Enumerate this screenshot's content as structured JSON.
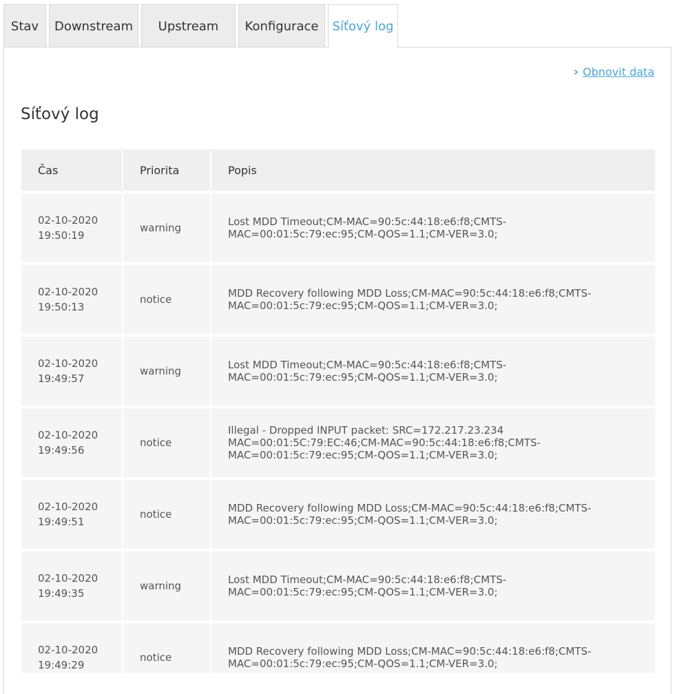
{
  "tabs": [
    {
      "label": "Stav",
      "width": 62,
      "active": false
    },
    {
      "label": "Downstream",
      "width": 130,
      "active": false
    },
    {
      "label": "Upstream",
      "width": 137,
      "active": false
    },
    {
      "label": "Konfigurace",
      "width": 126,
      "active": false
    },
    {
      "label": "Síťový log",
      "width": 102,
      "active": true
    }
  ],
  "refresh_label": "Obnovit data",
  "page_title": "Síťový log",
  "table": {
    "headers": [
      "Čas",
      "Priorita",
      "Popis"
    ],
    "rows": [
      {
        "time": "02-10-2020 19:50:19",
        "priority": "warning",
        "desc": "Lost MDD Timeout;CM-MAC=90:5c:44:18:e6:f8;CMTS-MAC=00:01:5c:79:ec:95;CM-QOS=1.1;CM-VER=3.0;"
      },
      {
        "time": "02-10-2020 19:50:13",
        "priority": "notice",
        "desc": "MDD Recovery following MDD Loss;CM-MAC=90:5c:44:18:e6:f8;CMTS-MAC=00:01:5c:79:ec:95;CM-QOS=1.1;CM-VER=3.0;"
      },
      {
        "time": "02-10-2020 19:49:57",
        "priority": "warning",
        "desc": "Lost MDD Timeout;CM-MAC=90:5c:44:18:e6:f8;CMTS-MAC=00:01:5c:79:ec:95;CM-QOS=1.1;CM-VER=3.0;"
      },
      {
        "time": "02-10-2020 19:49:56",
        "priority": "notice",
        "desc": "Illegal - Dropped INPUT packet: SRC=172.217.23.234 MAC=00:01:5C:79:EC:46;CM-MAC=90:5c:44:18:e6:f8;CMTS-MAC=00:01:5c:79:ec:95;CM-QOS=1.1;CM-VER=3.0;"
      },
      {
        "time": "02-10-2020 19:49:51",
        "priority": "notice",
        "desc": "MDD Recovery following MDD Loss;CM-MAC=90:5c:44:18:e6:f8;CMTS-MAC=00:01:5c:79:ec:95;CM-QOS=1.1;CM-VER=3.0;"
      },
      {
        "time": "02-10-2020 19:49:35",
        "priority": "warning",
        "desc": "Lost MDD Timeout;CM-MAC=90:5c:44:18:e6:f8;CMTS-MAC=00:01:5c:79:ec:95;CM-QOS=1.1;CM-VER=3.0;"
      },
      {
        "time": "02-10-2020 19:49:29",
        "priority": "notice",
        "desc": "MDD Recovery following MDD Loss;CM-MAC=90:5c:44:18:e6:f8;CMTS-MAC=00:01:5c:79:ec:95;CM-QOS=1.1;CM-VER=3.0;"
      }
    ]
  },
  "colors": {
    "accent": "#4aa6d6",
    "tab_bg": "#ececec",
    "header_bg": "#efefef",
    "row_bg": "#f5f5f5"
  }
}
